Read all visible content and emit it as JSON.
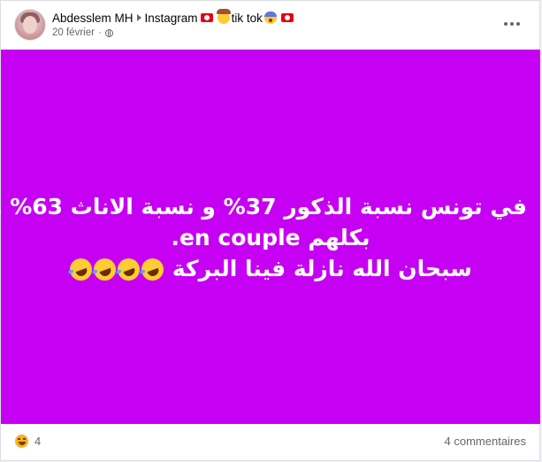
{
  "post": {
    "author": "Abdesslem MH",
    "destination": "Instagram",
    "destination_extra": "tik tok",
    "date": "20 février",
    "audience_icon": "globe-icon",
    "more_icon": "more-horizontal-icon",
    "background_color": "#c600f2",
    "text_lines": [
      "في تونس نسبة الذكور 37% و نسبة الاناث 63% و",
      "بكلهم en couple.",
      "سبحان الله نازلة فينا البركة"
    ],
    "laugh_emoji_count": 4
  },
  "footer": {
    "reaction_icon": "haha-reaction-icon",
    "reaction_count": "4",
    "comments": "4 commentaires"
  }
}
